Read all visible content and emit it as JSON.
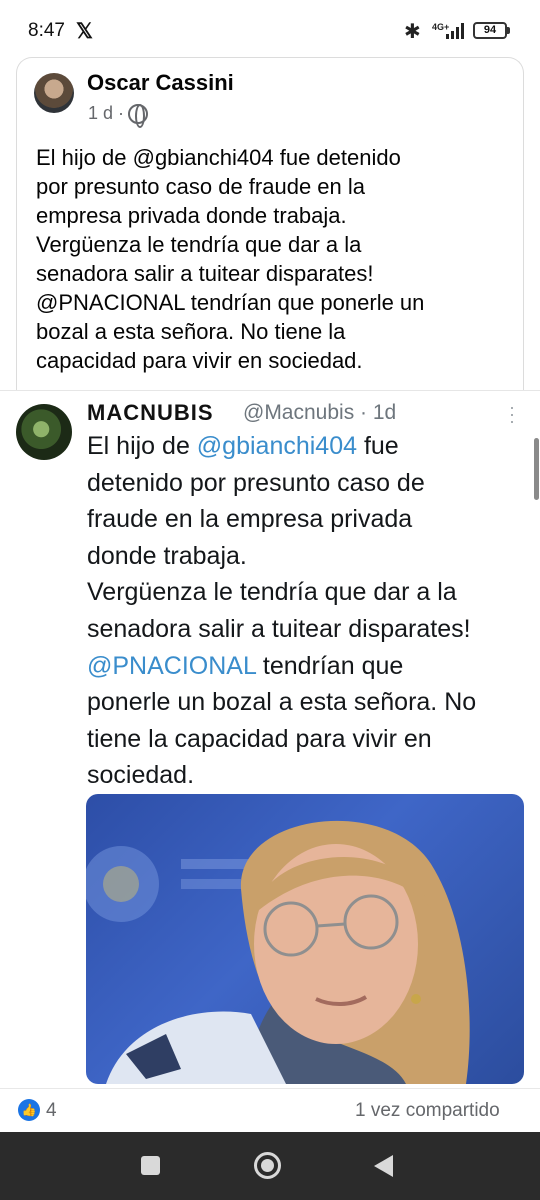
{
  "status_bar": {
    "time": "8:47",
    "x_logo": "𝕏",
    "network": "4G+",
    "battery": "94",
    "icons": [
      "x-logo-icon",
      "bluetooth-icon",
      "signal-icon",
      "battery-icon"
    ]
  },
  "post": {
    "author": "Oscar Cassini",
    "time": "1 d ·",
    "audience_icon": "globe-icon",
    "text_lines": [
      "El hijo de @gbianchi404 fue detenido",
      "por presunto caso de fraude en la",
      "empresa privada donde trabaja.",
      "Vergüenza le tendría que dar a la",
      "senadora salir a tuitear disparates!",
      "@PNACIONAL tendrían que ponerle un",
      "bozal a esta señora.  No tiene la",
      "capacidad para vivir en sociedad."
    ]
  },
  "tweet": {
    "name": "MACNUBIS",
    "handle": "@Macnubis · 1d",
    "more_icon": "more-vertical-icon",
    "lines": [
      {
        "pre": "El hijo de ",
        "mention": "@gbianchi404",
        "post": " fue"
      },
      {
        "pre": "detenido por presunto caso de",
        "mention": "",
        "post": ""
      },
      {
        "pre": "fraude en la empresa privada",
        "mention": "",
        "post": ""
      },
      {
        "pre": "donde trabaja.",
        "mention": "",
        "post": ""
      },
      {
        "pre": "Vergüenza le tendría que dar a la",
        "mention": "",
        "post": ""
      },
      {
        "pre": "senadora salir a tuitear disparates!",
        "mention": "",
        "post": ""
      },
      {
        "pre": "",
        "mention": "@PNACIONAL",
        "post": " tendrían que"
      },
      {
        "pre": "ponerle un bozal a esta señora.  No",
        "mention": "",
        "post": ""
      },
      {
        "pre": "tiene la capacidad para vivir en",
        "mention": "",
        "post": ""
      },
      {
        "pre": "sociedad.",
        "mention": "",
        "post": ""
      }
    ]
  },
  "footer": {
    "like_icon": "like-icon",
    "like_count": "4",
    "shares": "1 vez compartido"
  },
  "nav": {
    "icons": [
      "recents-icon",
      "home-icon",
      "back-icon"
    ]
  },
  "colors": {
    "mention": "#3a8dcc",
    "like_blue": "#1b74e4",
    "nav_bg": "#2b2b2b",
    "photo_bg": "#2d4ea7"
  }
}
